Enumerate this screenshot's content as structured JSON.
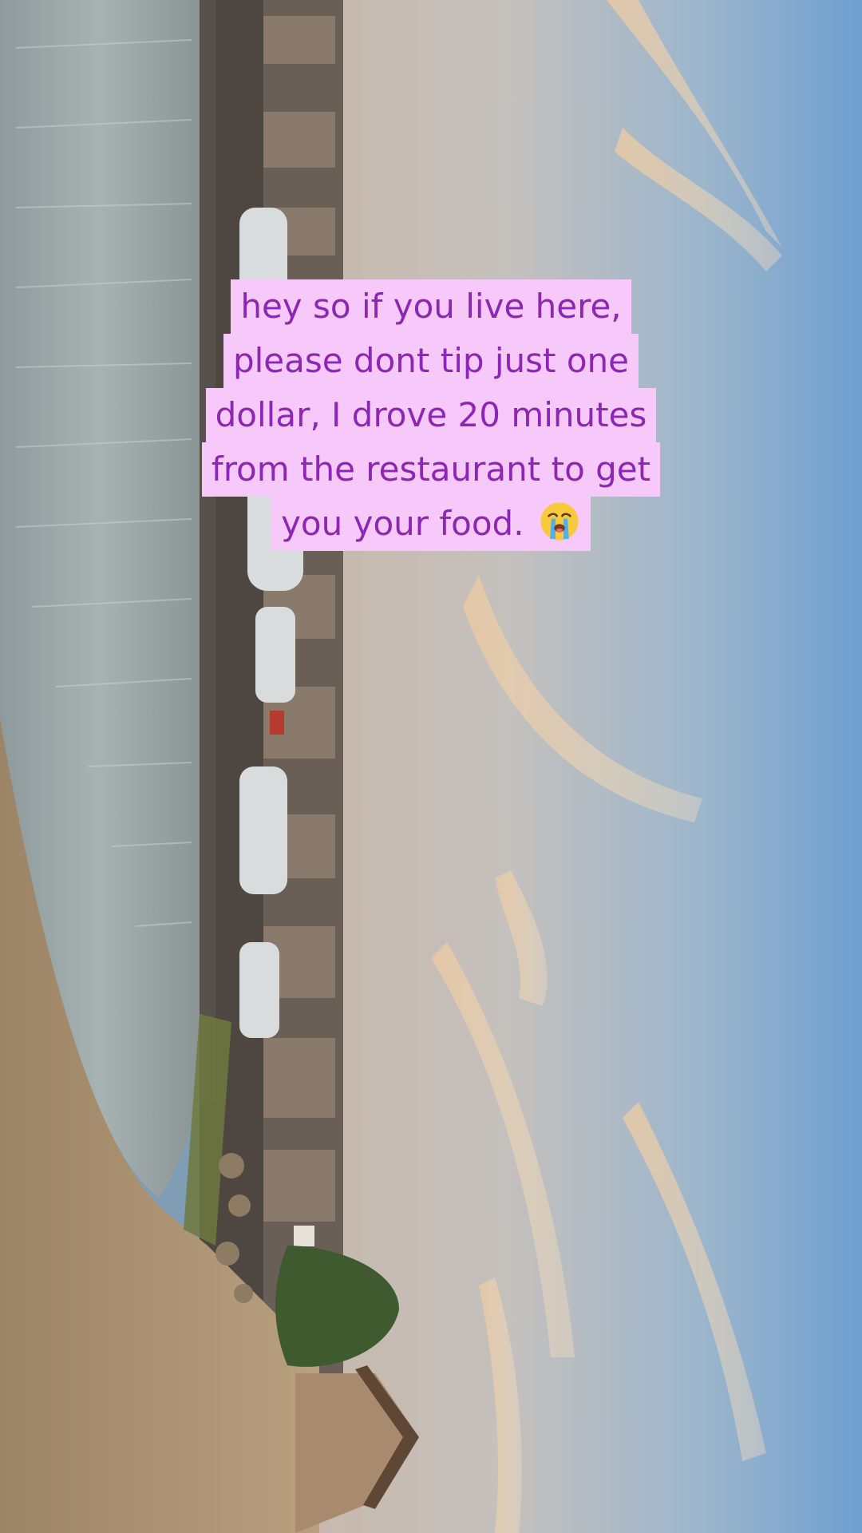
{
  "caption": {
    "lines": [
      "hey so if you live here,",
      "please dont tip just one",
      "dollar, I drove 20 minutes",
      "from the restaurant to get",
      "you your food."
    ],
    "trailing_emoji": "loudly-crying-face-emoji"
  },
  "colors": {
    "caption_background": "#f7c9fb",
    "caption_text": "#8c26b5",
    "sky": "#7fa4c6",
    "water": "#9aa7a8",
    "sand": "#b39a7a"
  }
}
